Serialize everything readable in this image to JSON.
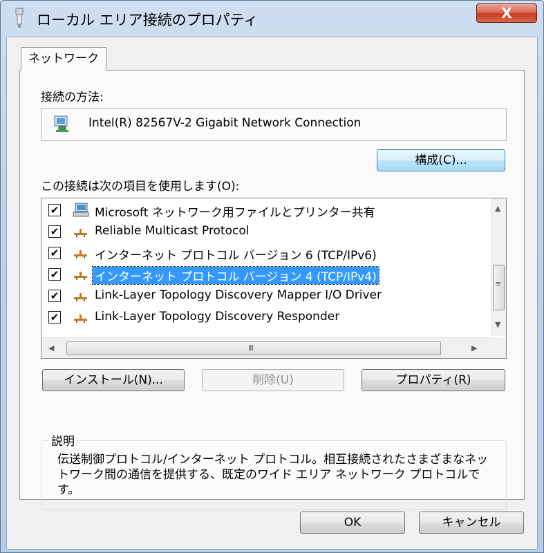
{
  "window": {
    "title": "ローカル エリア接続のプロパティ",
    "close_glyph": "X"
  },
  "tabs": [
    {
      "label": "ネットワーク"
    }
  ],
  "connect_using": {
    "label": "接続の方法:",
    "adapter_name": "Intel(R) 82567V-2 Gigabit Network Connection",
    "configure_button": "構成(C)..."
  },
  "items_section": {
    "label": "この接続は次の項目を使用します(O):",
    "items": [
      {
        "label": "Microsoft ネットワーク用ファイルとプリンター共有",
        "checked": true,
        "icon": "computer-icon",
        "selected": false
      },
      {
        "label": "Reliable Multicast Protocol",
        "checked": true,
        "icon": "network-protocol-icon",
        "selected": false
      },
      {
        "label": "インターネット プロトコル バージョン 6 (TCP/IPv6)",
        "checked": true,
        "icon": "network-protocol-icon",
        "selected": false
      },
      {
        "label": "インターネット プロトコル バージョン 4 (TCP/IPv4)",
        "checked": true,
        "icon": "network-protocol-icon",
        "selected": true
      },
      {
        "label": "Link-Layer Topology Discovery Mapper I/O Driver",
        "checked": true,
        "icon": "network-protocol-icon",
        "selected": false
      },
      {
        "label": "Link-Layer Topology Discovery Responder",
        "checked": true,
        "icon": "network-protocol-icon",
        "selected": false
      }
    ],
    "check_glyph": "✔"
  },
  "actions": {
    "install": "インストール(N)...",
    "uninstall": "削除(U)",
    "properties": "プロパティ(R)"
  },
  "description": {
    "title": "説明",
    "text": "伝送制御プロトコル/インターネット プロトコル。相互接続されたさまざまなネットワーク間の通信を提供する、既定のワイド エリア ネットワーク プロトコルです。"
  },
  "footer": {
    "ok": "OK",
    "cancel": "キャンセル"
  },
  "scroll": {
    "up": "▲",
    "down": "▼",
    "left": "◀",
    "right": "▶",
    "vgrip": "≡",
    "hgrip": "III"
  },
  "colors": {
    "selection": "#3399ff",
    "focus_border": "#3c7fb1"
  }
}
